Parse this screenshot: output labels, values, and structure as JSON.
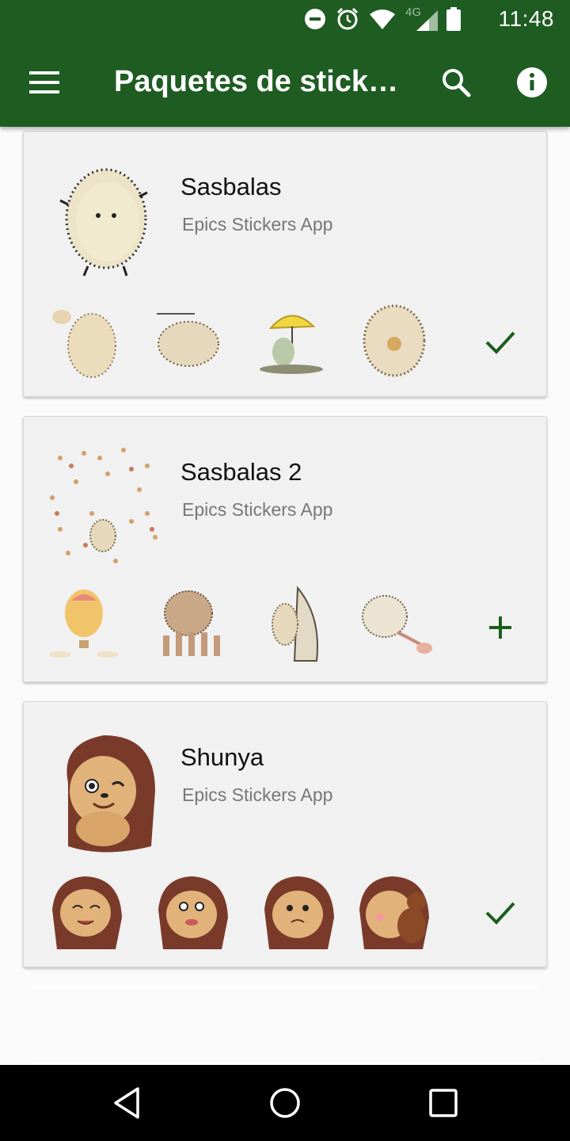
{
  "status_bar": {
    "time": "11:48",
    "network": "4G",
    "icons": [
      "do-not-disturb-icon",
      "alarm-icon",
      "wifi-icon",
      "cell-signal-icon",
      "battery-icon"
    ]
  },
  "app_bar": {
    "title": "Paquetes de sticke…",
    "icons": [
      "menu-icon",
      "search-icon",
      "info-icon"
    ]
  },
  "packs": [
    {
      "name": "Sasbalas",
      "publisher": "Epics Stickers App",
      "action": "check",
      "action_icon": "check-icon",
      "style": "sketch"
    },
    {
      "name": "Sasbalas 2",
      "publisher": "Epics Stickers App",
      "action": "add",
      "action_icon": "plus-icon",
      "style": "sketch"
    },
    {
      "name": "Shunya",
      "publisher": "Epics Stickers App",
      "action": "check",
      "action_icon": "check-icon",
      "style": "cartoon"
    }
  ],
  "colors": {
    "primary": "#1e5c22",
    "accent_icon": "#1b5e20",
    "card_bg": "#f1f1f1",
    "publisher_text": "#777777"
  },
  "nav_bar": {
    "icons": [
      "back-icon",
      "home-icon",
      "recents-icon"
    ]
  }
}
